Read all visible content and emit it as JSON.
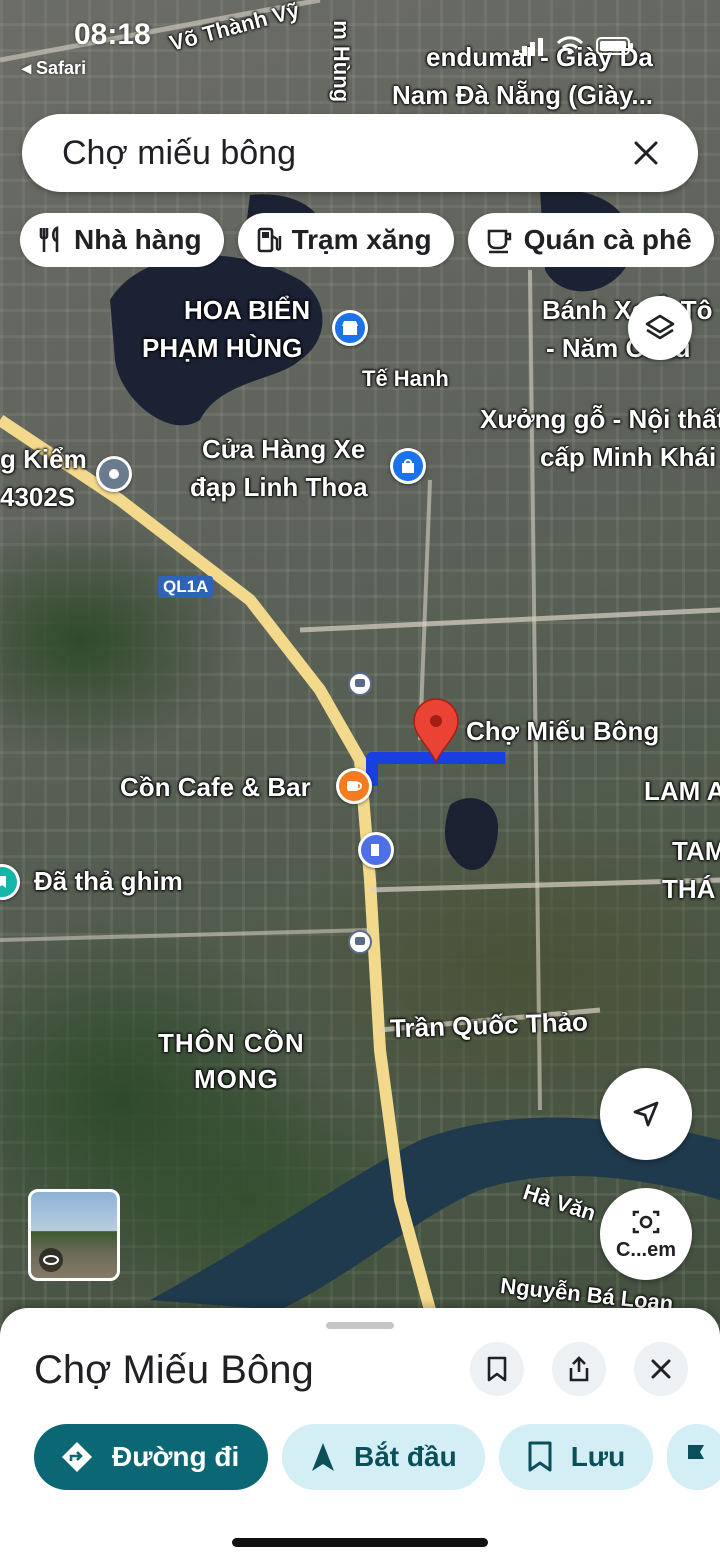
{
  "status_bar": {
    "time": "08:18",
    "back_app": "◂ Safari"
  },
  "search": {
    "query": "Chợ miếu bông"
  },
  "chips": [
    {
      "label": "Nhà hàng",
      "icon": "fork-knife-icon"
    },
    {
      "label": "Trạm xăng",
      "icon": "gas-station-icon"
    },
    {
      "label": "Quán cà phê",
      "icon": "coffee-cup-icon"
    }
  ],
  "map": {
    "labels": {
      "street_top": "Võ Thành Vỹ",
      "street_top_right": "m Hùng",
      "endumal": "endumal - Giày Da",
      "endumal2": "Nam Đà Nẵng (Giày...",
      "hoa_bien": "HOA BIỂN",
      "pham_hung": "PHẠM HÙNG",
      "banh_xe": "Bánh Xe Ô Tô",
      "nam_chau": "- Năm Châu",
      "te_hanh": "Tế Hanh",
      "xuong_go": "Xưởng gỗ - Nội thất",
      "minh_khai": "cấp Minh Khái",
      "kiem": "g Kiểm",
      "kiem2": "4302S",
      "cua_hang": "Cửa Hàng Xe",
      "linh_thoa": "đạp Linh Thoa",
      "ql1a": "QL1A",
      "cho_mieu_bong": "Chợ Miếu Bông",
      "lam_a": "LAM A",
      "tam": "TAM",
      "thai": "THÁ",
      "con_cafe": "Cồn Cafe & Bar",
      "da_tha_ghim": "Đã thả ghim",
      "tran_quoc_thao": "Trần Quốc Thảo",
      "thon_con": "THÔN CỒN",
      "mong": "MONG",
      "ha_van": "Hà Văn",
      "nguyen_ba_loan": "Nguyễn Bá Loan"
    },
    "lens_label": "C...em"
  },
  "sheet": {
    "title": "Chợ Miếu Bông",
    "actions": [
      {
        "label": "Đường đi",
        "icon": "directions-icon"
      },
      {
        "label": "Bắt đầu",
        "icon": "navigation-arrow-icon"
      },
      {
        "label": "Lưu",
        "icon": "bookmark-icon"
      }
    ]
  },
  "colors": {
    "accent": "#0b6773",
    "pin_red": "#ea4335",
    "route_blue": "#1a3fe0",
    "highway_yellow": "#f3d98b"
  }
}
